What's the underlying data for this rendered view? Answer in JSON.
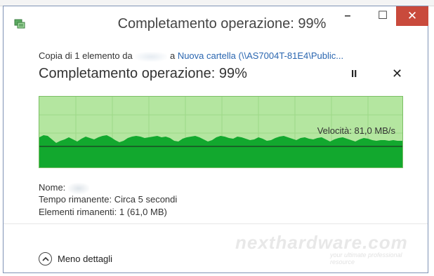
{
  "window": {
    "title": "Completamento operazione: 99%",
    "controls": {
      "minimize": "–",
      "maximize": "☐",
      "close": "✕"
    }
  },
  "copy_line": {
    "prefix": "Copia di 1 elemento da",
    "middle": "a",
    "destination": "Nuova cartella (\\\\AS7004T-81E4\\Public..."
  },
  "progress": {
    "heading": "Completamento operazione: 99%",
    "percent": 99,
    "pause_label": "II",
    "cancel_label": "✕"
  },
  "graph": {
    "speed_label": "Velocità: 81,0 MB/s",
    "fill_color": "#12a82e",
    "background_color": "#b4e6a0"
  },
  "details": {
    "name_label": "Nome:",
    "time_label": "Tempo rimanente:",
    "time_value": "Circa 5 secondi",
    "items_label": "Elementi rimanenti:",
    "items_value": "1 (61,0 MB)"
  },
  "footer": {
    "less_details": "Meno dettagli"
  },
  "watermark": {
    "text": "nexthardware.com",
    "subtext": "your ultimate professional resource"
  }
}
